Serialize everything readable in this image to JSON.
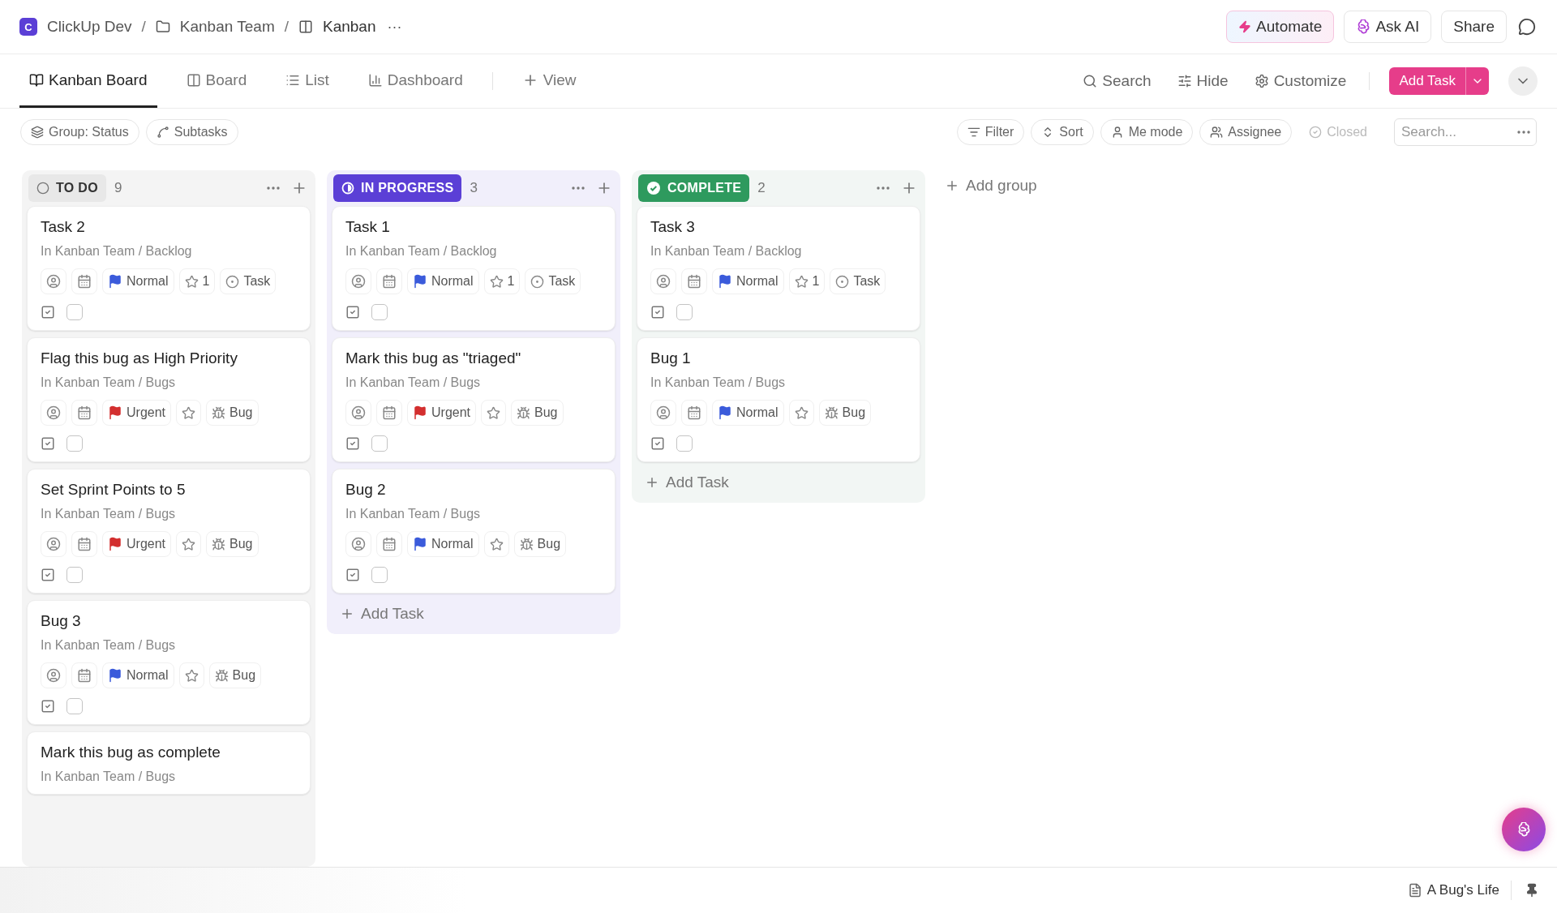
{
  "breadcrumb": {
    "logo_letter": "C",
    "items": [
      {
        "kind": "workspace",
        "label": "ClickUp Dev"
      },
      {
        "kind": "folder",
        "label": "Kanban Team"
      },
      {
        "kind": "board",
        "label": "Kanban"
      }
    ],
    "separator": "/",
    "more": "···"
  },
  "header_actions": [
    {
      "kind": "automate",
      "label": "Automate"
    },
    {
      "kind": "ai",
      "label": "Ask AI"
    },
    {
      "kind": "plain",
      "label": "Share"
    }
  ],
  "views": [
    {
      "kind": "kanban",
      "label": "Kanban Board",
      "selected": true
    },
    {
      "kind": "board",
      "label": "Board",
      "selected": false
    },
    {
      "kind": "list",
      "label": "List",
      "selected": false
    },
    {
      "kind": "dashboard",
      "label": "Dashboard",
      "selected": false
    }
  ],
  "add_view": "View",
  "view_tools": [
    {
      "kind": "search",
      "label": "Search"
    },
    {
      "kind": "hide",
      "label": "Hide"
    },
    {
      "kind": "customize",
      "label": "Customize"
    }
  ],
  "add_task_button": "Add Task",
  "left_filters": [
    {
      "kind": "group",
      "label": "Group: Status"
    },
    {
      "kind": "subtasks",
      "label": "Subtasks"
    }
  ],
  "right_filters": [
    {
      "kind": "filter",
      "label": "Filter",
      "disabled": false
    },
    {
      "kind": "sort",
      "label": "Sort",
      "disabled": false
    },
    {
      "kind": "me",
      "label": "Me mode",
      "disabled": false
    },
    {
      "kind": "assignee",
      "label": "Assignee",
      "disabled": false
    },
    {
      "kind": "closed",
      "label": "Closed",
      "disabled": true
    }
  ],
  "search": {
    "placeholder": "Search..."
  },
  "columns": [
    {
      "status": "TO DO",
      "kind": "todo",
      "color": "#e8e8e8",
      "count": "9",
      "cards": [
        {
          "title": "Task 2",
          "path": "In Kanban Team / Backlog",
          "priority": {
            "label": "Normal",
            "color": "#3b5bdb"
          },
          "points": "1",
          "type": {
            "kind": "task",
            "label": "Task"
          },
          "checked": false
        },
        {
          "title": "Flag this bug as High Priority",
          "path": "In Kanban Team / Bugs",
          "priority": {
            "label": "Urgent",
            "color": "#d32f2f"
          },
          "type": {
            "kind": "bug",
            "label": "Bug"
          },
          "checked": false
        },
        {
          "title": "Set Sprint Points to 5",
          "path": "In Kanban Team / Bugs",
          "priority": {
            "label": "Urgent",
            "color": "#d32f2f"
          },
          "type": {
            "kind": "bug",
            "label": "Bug"
          },
          "checked": false
        },
        {
          "title": "Bug 3",
          "path": "In Kanban Team / Bugs",
          "priority": {
            "label": "Normal",
            "color": "#3b5bdb"
          },
          "type": {
            "kind": "bug",
            "label": "Bug"
          },
          "checked": false
        },
        {
          "title": "Mark this bug as complete",
          "path": "In Kanban Team / Bugs"
        }
      ]
    },
    {
      "status": "IN PROGRESS",
      "kind": "in_progress",
      "color": "#5b3fd6",
      "count": "3",
      "add_task": "Add Task",
      "cards": [
        {
          "title": "Task 1",
          "path": "In Kanban Team / Backlog",
          "priority": {
            "label": "Normal",
            "color": "#3b5bdb"
          },
          "points": "1",
          "type": {
            "kind": "task",
            "label": "Task"
          },
          "checked": false
        },
        {
          "title": "Mark this bug as \"triaged\"",
          "path": "In Kanban Team / Bugs",
          "priority": {
            "label": "Urgent",
            "color": "#d32f2f"
          },
          "type": {
            "kind": "bug",
            "label": "Bug"
          },
          "checked": false
        },
        {
          "title": "Bug 2",
          "path": "In Kanban Team / Bugs",
          "priority": {
            "label": "Normal",
            "color": "#3b5bdb"
          },
          "type": {
            "kind": "bug",
            "label": "Bug"
          },
          "checked": false
        }
      ]
    },
    {
      "status": "COMPLETE",
      "kind": "complete",
      "color": "#2e9a5e",
      "count": "2",
      "add_task": "Add Task",
      "cards": [
        {
          "title": "Task 3",
          "path": "In Kanban Team / Backlog",
          "priority": {
            "label": "Normal",
            "color": "#3b5bdb"
          },
          "points": "1",
          "type": {
            "kind": "task",
            "label": "Task"
          },
          "checked": false
        },
        {
          "title": "Bug 1",
          "path": "In Kanban Team / Bugs",
          "priority": {
            "label": "Normal",
            "color": "#3b5bdb"
          },
          "type": {
            "kind": "bug",
            "label": "Bug"
          },
          "checked": false
        }
      ]
    }
  ],
  "add_group": "Add group",
  "footer": {
    "doc": "A Bug's Life"
  }
}
